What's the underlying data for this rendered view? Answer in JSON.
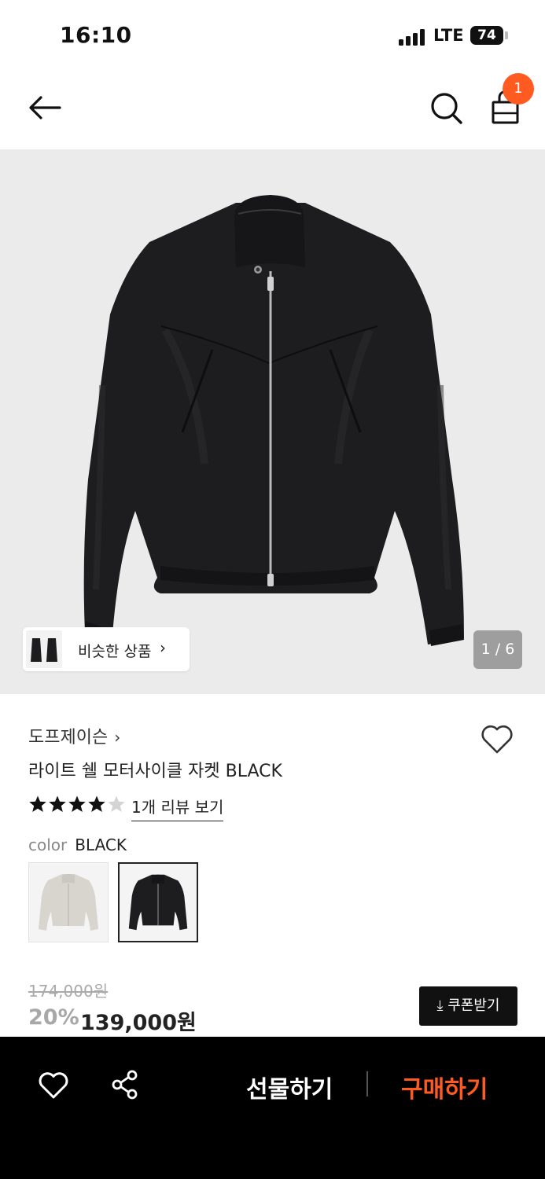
{
  "status_bar": {
    "time": "16:10",
    "network": "LTE",
    "battery": "74"
  },
  "header": {
    "cart_count": "1"
  },
  "gallery": {
    "similar_label": "비슷한 상품",
    "page_counter": "1 / 6"
  },
  "product": {
    "brand": "도프제이슨",
    "name": "라이트 쉘 모터사이클 자켓 BLACK",
    "rating": 4,
    "rating_max": 5,
    "review_link": "1개 리뷰 보기",
    "color_label": "color",
    "color_value": "BLACK",
    "swatches": [
      "light-gray-jacket",
      "black-jacket"
    ],
    "original_price": "174,000원",
    "discount": "20%",
    "price": "139,000원",
    "coupon_label": "쿠폰받기"
  },
  "bottom_bar": {
    "gift_label": "선물하기",
    "buy_label": "구매하기"
  },
  "colors": {
    "accent": "#ff5a1f",
    "dark": "#111111",
    "gallery_bg": "#ebebeb"
  }
}
